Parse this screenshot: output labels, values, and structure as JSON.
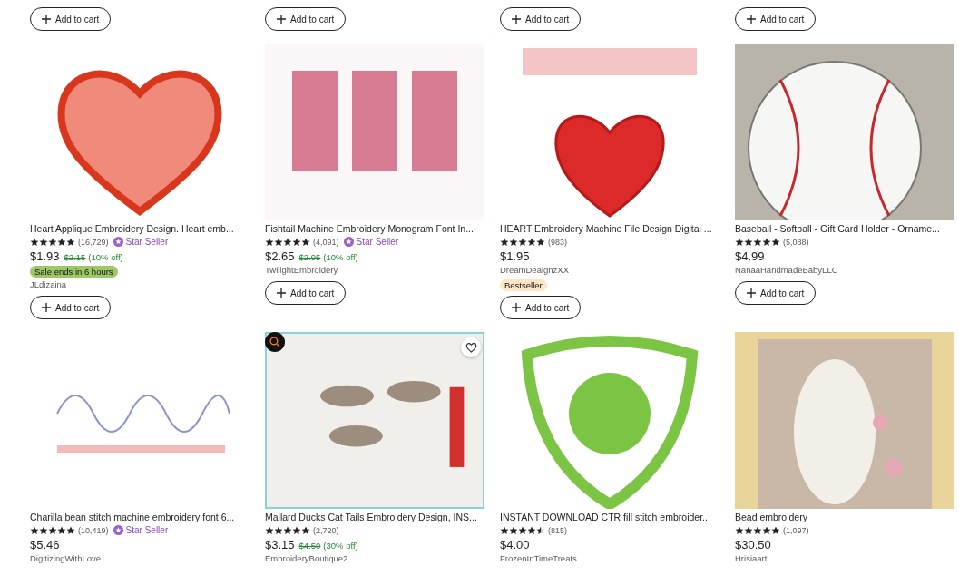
{
  "top_buttons": [
    "Add to cart",
    "Add to cart",
    "Add to cart",
    "Add to cart"
  ],
  "listings": [
    {
      "hovered": false,
      "title": "Heart Applique Embroidery Design. Heart emb...",
      "stars": 5,
      "reviews": "(16,729)",
      "star_seller": "Star Seller",
      "price": "$1.93",
      "original_price": "$2.15",
      "discount": "(10% off)",
      "badge": {
        "kind": "sale",
        "text": "Sale ends in 6 hours"
      },
      "shop": "JLdizaina",
      "cart_button": "Add to cart"
    },
    {
      "hovered": false,
      "title": "Fishtail Machine Embroidery Monogram Font In...",
      "stars": 5,
      "reviews": "(4,091)",
      "star_seller": "Star Seller",
      "price": "$2.65",
      "original_price": "$2.95",
      "discount": "(10% off)",
      "shop": "TwilightEmbroidery",
      "cart_button": "Add to cart"
    },
    {
      "hovered": false,
      "title": "HEART Embroidery Machine File Design Digital ...",
      "stars": 5,
      "reviews": "(983)",
      "price": "$1.95",
      "shop": "DreamDeaignzXX",
      "badge": {
        "kind": "bestseller",
        "text": "Bestseller"
      },
      "cart_button": "Add to cart"
    },
    {
      "hovered": false,
      "title": "Baseball - Softball - Gift Card Holder - Orname...",
      "stars": 5,
      "reviews": "(5,088)",
      "price": "$4.99",
      "shop": "NanaaHandmadeBabyLLC",
      "cart_button": "Add to cart"
    },
    {
      "hovered": false,
      "title": "Charilla bean stitch machine embroidery font 6...",
      "stars": 5,
      "reviews": "(10,419)",
      "star_seller": "Star Seller",
      "price": "$5.46",
      "shop": "DigitizingWithLove"
    },
    {
      "hovered": true,
      "title": "Mallard Ducks Cat Tails Embroidery Design, INS...",
      "stars": 5,
      "reviews": "(2,720)",
      "price": "$3.15",
      "original_price": "$4.50",
      "discount": "(30% off)",
      "shop": "EmbroideryBoutique2"
    },
    {
      "hovered": false,
      "title": "INSTANT DOWNLOAD CTR fill stitch embroider...",
      "stars": 4.5,
      "reviews": "(815)",
      "price": "$4.00",
      "shop": "FrozenInTimeTreats"
    },
    {
      "hovered": false,
      "title": "Bead embroidery",
      "stars": 5,
      "reviews": "(1,097)",
      "price": "$30.50",
      "shop": "Hrisiaart"
    }
  ]
}
